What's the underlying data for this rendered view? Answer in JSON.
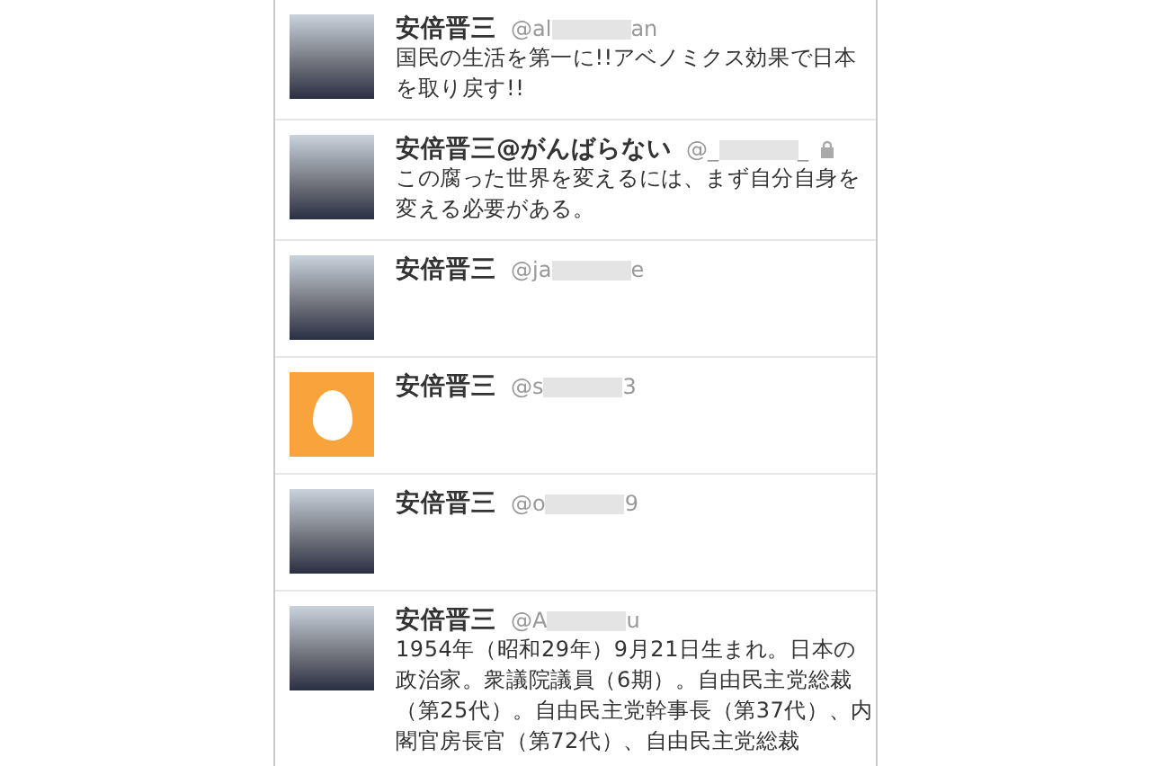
{
  "users": [
    {
      "name": "安倍晋三",
      "handle_start": "@al",
      "handle_end": "an",
      "protected": false,
      "avatar": {
        "kind": "photo"
      },
      "bio": "国民の生活を第一に!!アベノミクス効果で日本を取り戻す!!"
    },
    {
      "name": "安倍晋三@がんばらない",
      "handle_start": "@_",
      "handle_end": "_",
      "protected": true,
      "avatar": {
        "kind": "photo"
      },
      "bio": "この腐った世界を変えるには、まず自分自身を変える必要がある。"
    },
    {
      "name": "安倍晋三",
      "handle_start": "@ja",
      "handle_end": "e",
      "protected": false,
      "avatar": {
        "kind": "photo"
      }
    },
    {
      "name": "安倍晋三",
      "handle_start": "@s",
      "handle_end": "3",
      "protected": false,
      "avatar": {
        "kind": "egg"
      }
    },
    {
      "name": "安倍晋三",
      "handle_start": "@o",
      "handle_end": "9",
      "protected": false,
      "avatar": {
        "kind": "photo"
      }
    },
    {
      "name": "安倍晋三",
      "handle_start": "@A",
      "handle_end": "u",
      "protected": false,
      "avatar": {
        "kind": "photo"
      },
      "bio": "1954年（昭和29年）9月21日生まれ。日本の政治家。衆議院議員（6期）。自由民主党総裁（第25代）。自由民主党幹事長（第37代）、内閣官房長官（第72代）、自由民主党総裁"
    }
  ]
}
